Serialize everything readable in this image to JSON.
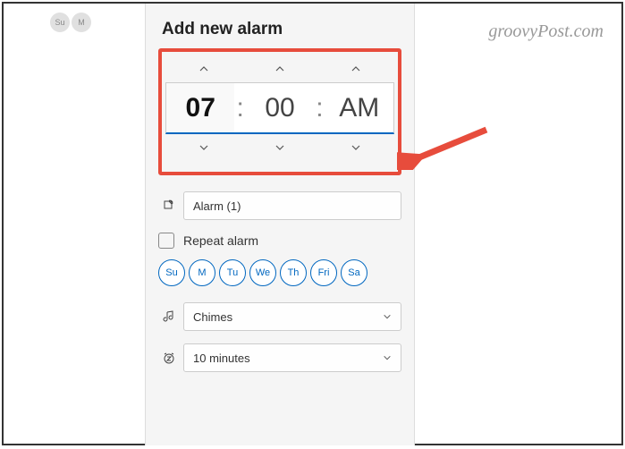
{
  "title": "Add new alarm",
  "time": {
    "hours": "07",
    "minutes": "00",
    "ampm": "AM"
  },
  "alarm_name": "Alarm (1)",
  "repeat_label": "Repeat alarm",
  "days": [
    "Su",
    "M",
    "Tu",
    "We",
    "Th",
    "Fri",
    "Sa"
  ],
  "sound": "Chimes",
  "snooze": "10 minutes",
  "bg_chips": [
    "Su",
    "M"
  ],
  "watermark": "groovyPost.com"
}
